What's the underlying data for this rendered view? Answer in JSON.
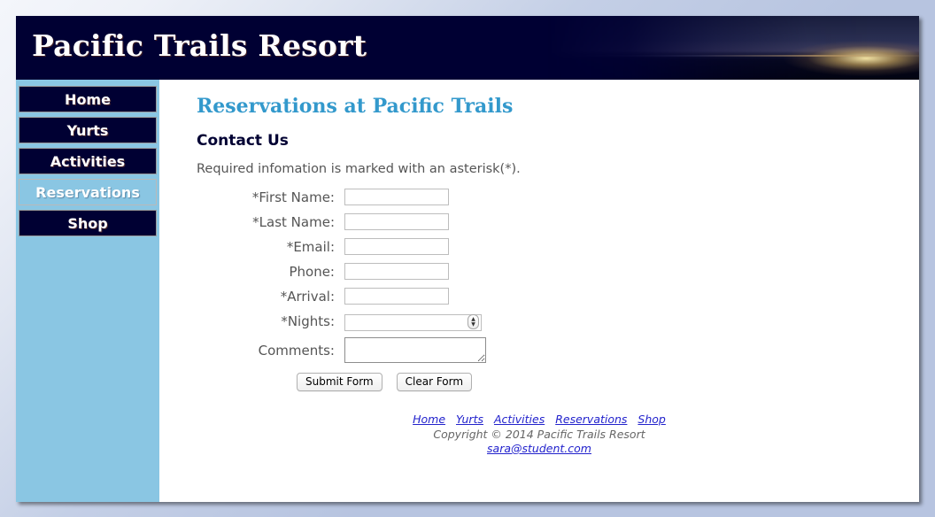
{
  "site": {
    "title": "Pacific Trails Resort",
    "header_image": "coastal-sunset-photo"
  },
  "sidebar": {
    "items": [
      {
        "label": "Home",
        "active": false
      },
      {
        "label": "Yurts",
        "active": false
      },
      {
        "label": "Activities",
        "active": false
      },
      {
        "label": "Reservations",
        "active": true
      },
      {
        "label": "Shop",
        "active": false
      }
    ]
  },
  "main": {
    "page_title": "Reservations at Pacific Trails",
    "section_title": "Contact Us",
    "intro": "Required infomation is marked with an asterisk(*).",
    "form": {
      "fields": [
        {
          "label": "*First Name:",
          "type": "text",
          "value": "",
          "placeholder": "",
          "name": "first-name"
        },
        {
          "label": "*Last Name:",
          "type": "text",
          "value": "",
          "placeholder": "",
          "name": "last-name"
        },
        {
          "label": "*Email:",
          "type": "text",
          "value": "",
          "placeholder": "",
          "name": "email"
        },
        {
          "label": "Phone:",
          "type": "text",
          "value": "",
          "placeholder": "",
          "name": "phone"
        },
        {
          "label": "*Arrival:",
          "type": "text",
          "value": "",
          "placeholder": "",
          "name": "arrival"
        },
        {
          "label": "*Nights:",
          "type": "number",
          "value": "",
          "placeholder": "",
          "name": "nights"
        },
        {
          "label": "Comments:",
          "type": "textarea",
          "value": "",
          "placeholder": "",
          "name": "comments"
        }
      ],
      "submit_label": "Submit Form",
      "clear_label": "Clear Form"
    }
  },
  "footer": {
    "links": [
      "Home",
      "Yurts",
      "Activities",
      "Reservations",
      "Shop"
    ],
    "copyright": "Copyright © 2014 Pacific Trails Resort",
    "email": "sara@student.com"
  },
  "colors": {
    "navy": "#000033",
    "sky": "#8ac6e3",
    "heading_blue": "#3399cc",
    "link_blue": "#2222cc",
    "backdrop": "#b7c4e0"
  }
}
